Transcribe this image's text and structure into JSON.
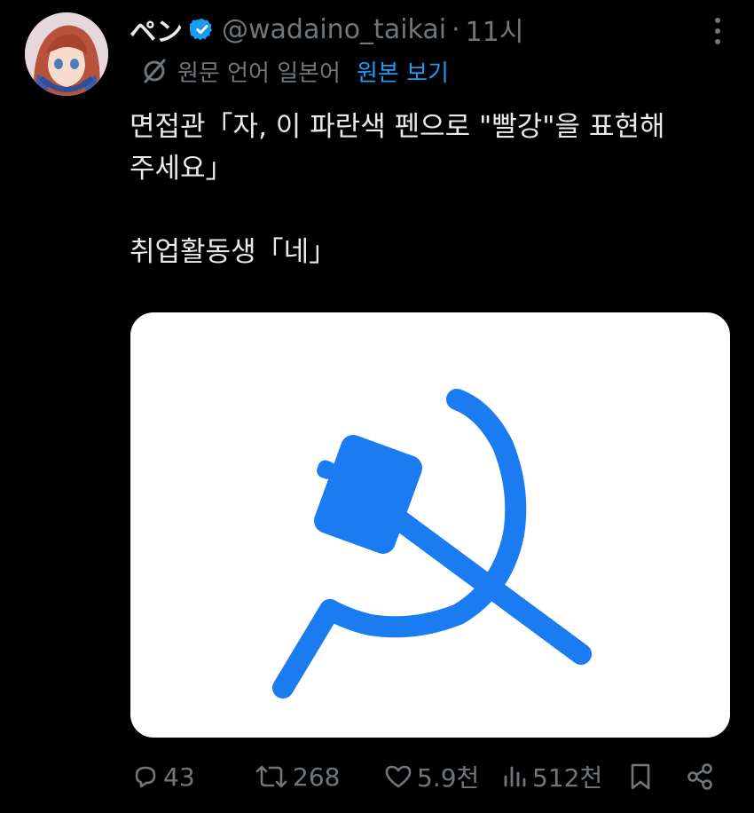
{
  "tweet": {
    "author": {
      "display_name": "ペン",
      "handle": "@wadaino_taikai",
      "verified": true
    },
    "separator": "·",
    "time": "11시",
    "translation": {
      "label": "원문 언어 일본어",
      "view_original": "원본 보기"
    },
    "text_lines": [
      "면접관「자, 이 파란색 펜으로 \"빨강\"을 표현해",
      "주세요」",
      "",
      "취업활동생「네」"
    ],
    "media": {
      "stroke_color": "#1a7cf0"
    }
  },
  "actions": {
    "replies": "43",
    "retweets": "268",
    "likes": "5.9천",
    "views": "512천"
  },
  "colors": {
    "background": "#000000",
    "text": "#e7e9ea",
    "muted": "#71767b",
    "link": "#1d9bf0",
    "verified": "#1d9bf0"
  }
}
